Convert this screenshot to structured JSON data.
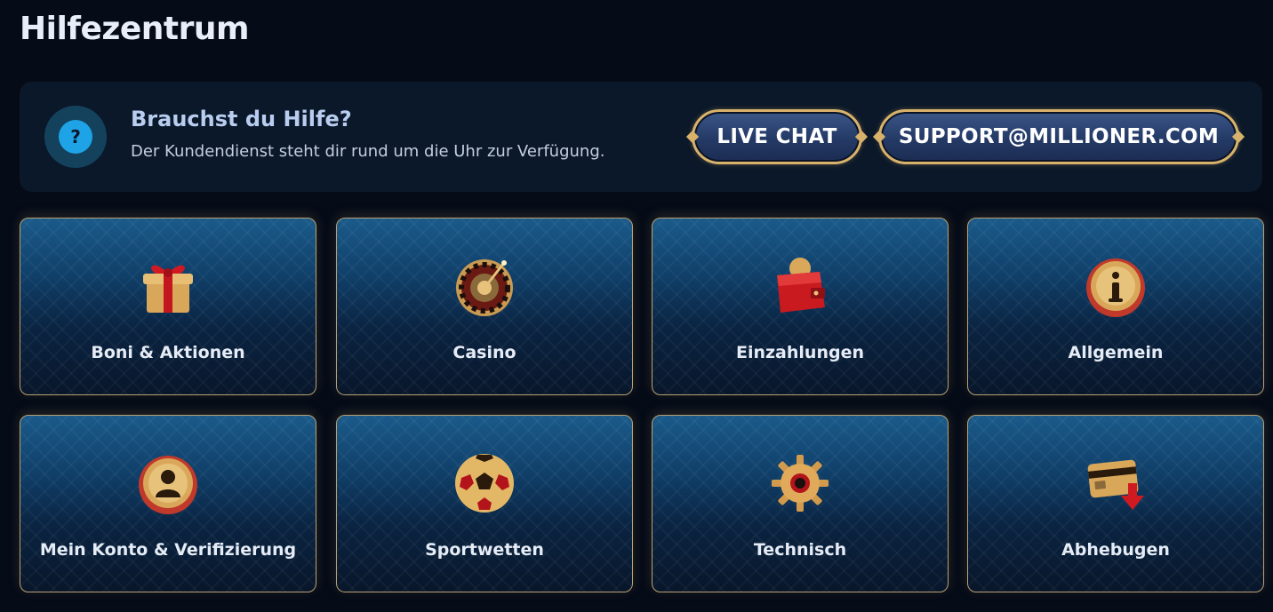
{
  "page": {
    "title": "Hilfezentrum"
  },
  "help": {
    "title": "Brauchst du Hilfe?",
    "subtitle": "Der Kundendienst steht dir rund um die Uhr zur Verfügung.",
    "icon": "question-icon",
    "live_chat_label": "LIVE CHAT",
    "email_label": "SUPPORT@MILLIONER.COM"
  },
  "categories": [
    {
      "label": "Boni & Aktionen",
      "icon": "gift-icon"
    },
    {
      "label": "Casino",
      "icon": "roulette-icon"
    },
    {
      "label": "Einzahlungen",
      "icon": "wallet-icon"
    },
    {
      "label": "Allgemein",
      "icon": "info-icon"
    },
    {
      "label": "Mein Konto & Verifizierung",
      "icon": "user-icon"
    },
    {
      "label": "Sportwetten",
      "icon": "football-icon"
    },
    {
      "label": "Technisch",
      "icon": "gear-icon"
    },
    {
      "label": "Abhebugen",
      "icon": "card-withdraw-icon"
    }
  ],
  "colors": {
    "background": "#050b17",
    "panel": "#0b1829",
    "accent_gold": "#d8b26a",
    "help_blue": "#1ea4e6"
  }
}
